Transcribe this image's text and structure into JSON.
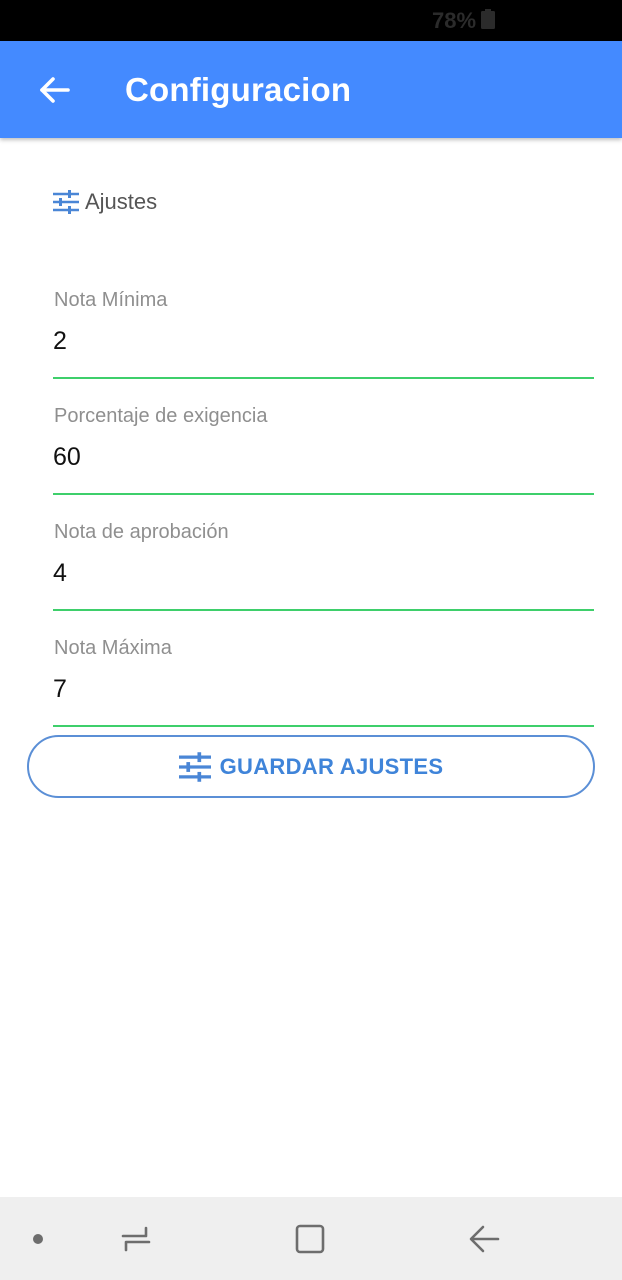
{
  "status_bar": {
    "battery_percent": "78%",
    "battery_icon": "battery-icon"
  },
  "app_bar": {
    "title": "Configuracion",
    "back_icon": "arrow-back-icon",
    "color": "#448aff"
  },
  "section": {
    "icon": "tune-icon",
    "label": "Ajustes"
  },
  "fields": [
    {
      "label": "Nota Mínima",
      "value": "2"
    },
    {
      "label": "Porcentaje de exigencia",
      "value": "60"
    },
    {
      "label": "Nota de aprobación",
      "value": "4"
    },
    {
      "label": "Nota Máxima",
      "value": "7"
    }
  ],
  "save_button": {
    "label": "GUARDAR AJUSTES",
    "icon": "tune-icon",
    "color": "#3f84d9"
  },
  "field_underline_color": "#3ecf6b",
  "nav_bar": {
    "items": [
      "dot-icon",
      "recents-icon",
      "home-icon",
      "back-icon"
    ]
  }
}
